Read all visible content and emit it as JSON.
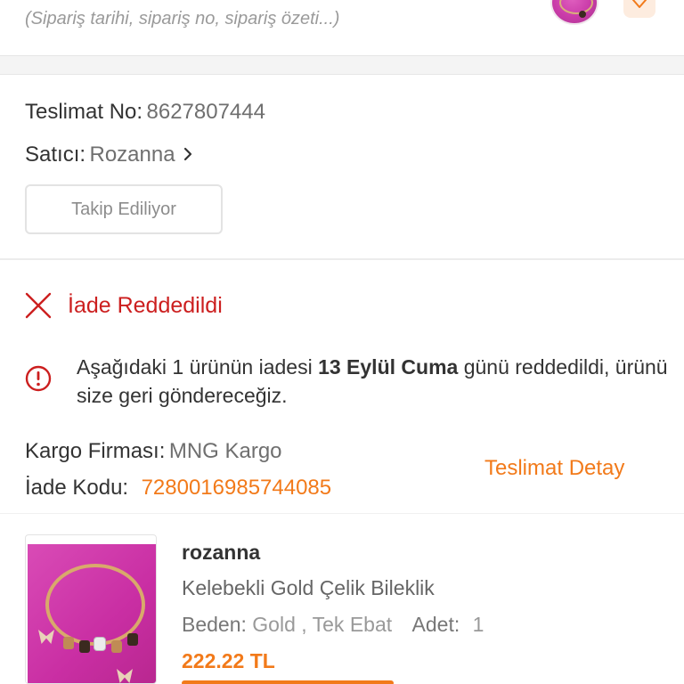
{
  "header": {
    "search_hint": "(Sipariş tarihi, sipariş no, sipariş özeti...)",
    "favorite_icon": "heart-outline-icon"
  },
  "shipment": {
    "delivery_no_label": "Teslimat No:",
    "delivery_no": "8627807444",
    "seller_label": "Satıcı:",
    "seller": "Rozanna",
    "follow_button": "Takip Ediliyor"
  },
  "return_status": {
    "title": "İade Reddedildi",
    "status_color": "#cc1f1f",
    "message_prefix": "Aşağıdaki 1 ürünün iadesi ",
    "message_date": "13 Eylül Cuma",
    "message_suffix": " günü reddedildi, ürünü size geri göndereceğiz.",
    "cargo_label": "Kargo Firması:",
    "cargo_company": "MNG Kargo",
    "return_code_label": "İade Kodu:",
    "return_code": "7280016985744085",
    "detail_link": "Teslimat Detay"
  },
  "product": {
    "brand": "rozanna",
    "name": "Kelebekli Gold Çelik Bileklik",
    "size_label": "Beden:",
    "size": "Gold , Tek Ebat",
    "qty_label": "Adet:",
    "qty": "1",
    "price": "222.22 TL"
  },
  "colors": {
    "accent": "#f27a1a",
    "danger": "#cc1f1f"
  }
}
